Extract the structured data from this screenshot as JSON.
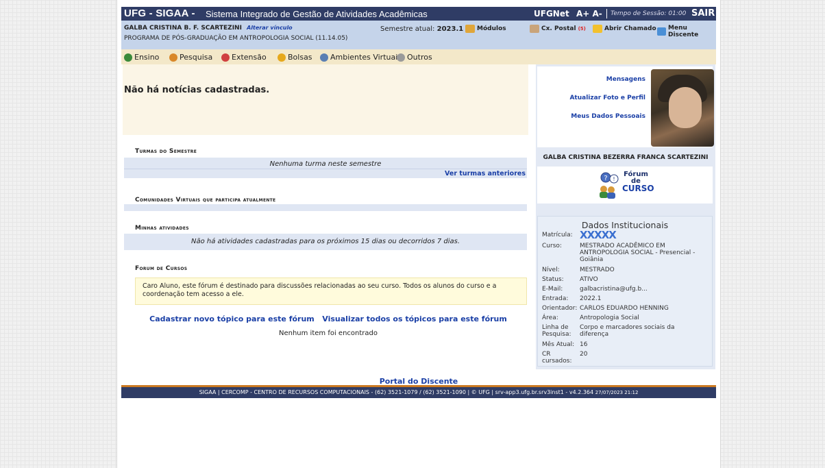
{
  "header": {
    "app_title": "UFG - SIGAA -",
    "app_subtitle": "Sistema Integrado de Gestão de Atividades Acadêmicas",
    "ufgnet": "UFGNet",
    "font_controls": "A+ A-",
    "session_label": "Tempo de Sessão: 01:00",
    "logout": "SAIR"
  },
  "user": {
    "name": "GALBA CRISTINA B. F. SCARTEZINI",
    "change_link": "Alterar vínculo",
    "program": "PROGRAMA DE PÓS-GRADUAÇÃO EM ANTROPOLOGIA SOCIAL (11.14.05)",
    "semester_label": "Semestre atual:",
    "semester_value": "2023.1"
  },
  "toolbar": {
    "modules": "Módulos",
    "mailbox": "Cx. Postal",
    "mailbox_count": "(5)",
    "open_ticket": "Abrir Chamado",
    "student_menu": "Menu Discente"
  },
  "menu": [
    "Ensino",
    "Pesquisa",
    "Extensão",
    "Bolsas",
    "Ambientes Virtuais",
    "Outros"
  ],
  "news": {
    "empty_message": "Não há notícias cadastradas."
  },
  "sections": {
    "classes": {
      "title": "Turmas do Semestre",
      "empty": "Nenhuma turma neste semestre",
      "link": "Ver turmas anteriores"
    },
    "communities": {
      "title": "Comunidades Virtuais que participa atualmente"
    },
    "activities": {
      "title": "Minhas atividades",
      "empty": "Não há atividades cadastradas para os próximos 15 dias ou decorridos 7 dias."
    },
    "forum": {
      "title": "Forum de Cursos",
      "description": "Caro Aluno, este fórum é destinado para discussões relacionadas ao seu curso. Todos os alunos do curso e a coordenação tem acesso a ele.",
      "new_topic": "Cadastrar novo tópico para este fórum",
      "view_all": "Visualizar todos os tópicos para este fórum",
      "empty": "Nenhum item foi encontrado"
    }
  },
  "profile": {
    "messages": "Mensagens",
    "update_photo": "Atualizar Foto e Perfil",
    "personal_data": "Meus Dados Pessoais",
    "full_name": "GALBA CRISTINA BEZERRA FRANCA SCARTEZINI",
    "forum_logo": {
      "line1": "Fórum",
      "line2": "de",
      "line3": "CURSO"
    }
  },
  "institutional": {
    "title": "Dados Institucionais",
    "rows": [
      {
        "k": "Matrícula:",
        "v": "XXXXX"
      },
      {
        "k": "Curso:",
        "v": "MESTRADO ACADÊMICO EM ANTROPOLOGIA SOCIAL - Presencial - Goiânia"
      },
      {
        "k": "Nível:",
        "v": "MESTRADO"
      },
      {
        "k": "Status:",
        "v": "ATIVO"
      },
      {
        "k": "E-Mail:",
        "v": "galbacristina@ufg.b..."
      },
      {
        "k": "Entrada:",
        "v": "2022.1"
      },
      {
        "k": "Orientador:",
        "v": "CARLOS EDUARDO HENNING"
      },
      {
        "k": "Área:",
        "v": "Antropologia Social"
      },
      {
        "k": "Linha de Pesquisa:",
        "v": "Corpo e marcadores sociais da diferença"
      },
      {
        "k": "Mês Atual:",
        "v": "16"
      },
      {
        "k": "CR cursados:",
        "v": "20"
      }
    ]
  },
  "footer": {
    "portal": "Portal do Discente",
    "text": "SIGAA | CERCOMP - CENTRO DE RECURSOS COMPUTACIONAIS - (62) 3521-1079 / (62) 3521-1090 | © UFG | srv-app3.ufg.br.srv3inst1 - v4.2.364",
    "timestamp": "27/07/2023 21:12"
  }
}
